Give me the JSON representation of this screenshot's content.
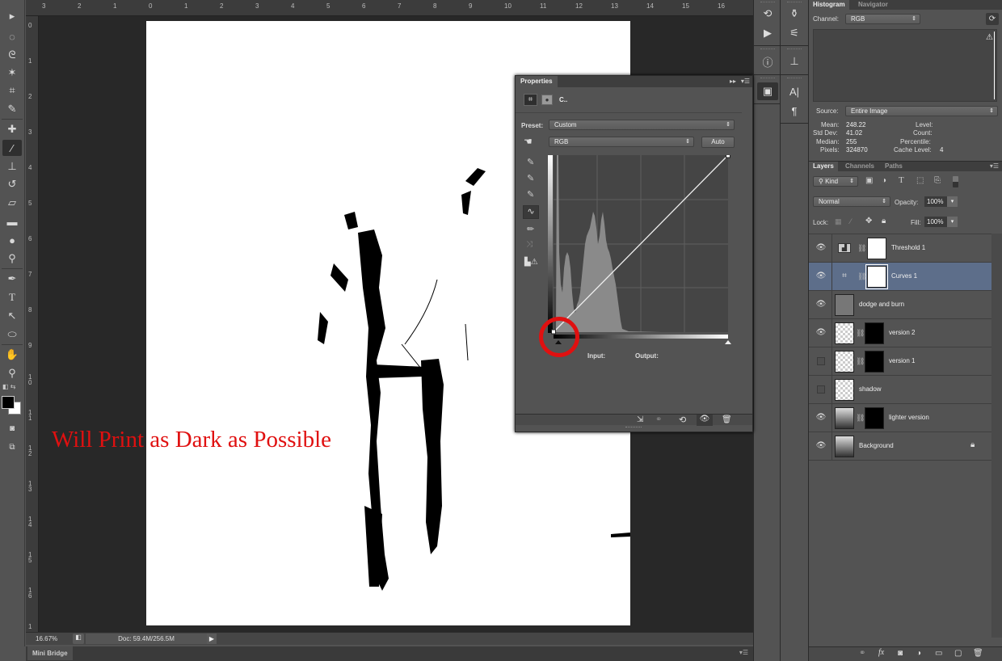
{
  "toolbar": {
    "tools": [
      {
        "name": "move-tool",
        "glyph": "▸✥"
      },
      {
        "name": "marquee-tool",
        "glyph": "◌"
      },
      {
        "name": "lasso-tool",
        "glyph": "ᘓ"
      },
      {
        "name": "magic-wand-tool",
        "glyph": "✶"
      },
      {
        "name": "crop-tool",
        "glyph": "⌗"
      },
      {
        "name": "eyedropper-tool",
        "glyph": "✎"
      },
      {
        "name": "healing-brush-tool",
        "glyph": "✚"
      },
      {
        "name": "brush-tool",
        "glyph": "⁄"
      },
      {
        "name": "clone-stamp-tool",
        "glyph": "⊥"
      },
      {
        "name": "history-brush-tool",
        "glyph": "↺"
      },
      {
        "name": "eraser-tool",
        "glyph": "▱"
      },
      {
        "name": "gradient-tool",
        "glyph": "▬"
      },
      {
        "name": "blur-tool",
        "glyph": "●"
      },
      {
        "name": "dodge-tool",
        "glyph": "⚲"
      },
      {
        "name": "pen-tool",
        "glyph": "✒"
      },
      {
        "name": "type-tool",
        "glyph": "T"
      },
      {
        "name": "path-selection-tool",
        "glyph": "↖"
      },
      {
        "name": "ellipse-tool",
        "glyph": "⬭"
      },
      {
        "name": "hand-tool",
        "glyph": "✋"
      },
      {
        "name": "zoom-tool",
        "glyph": "⚲"
      }
    ],
    "foreground_color": "#000000",
    "background_color": "#ffffff"
  },
  "rulers": {
    "top": [
      "3",
      "2",
      "1",
      "0",
      "1",
      "2",
      "3",
      "4",
      "5",
      "6",
      "7",
      "8",
      "9",
      "10",
      "11",
      "12",
      "13",
      "14",
      "15",
      "16"
    ],
    "left": [
      "0",
      "1",
      "2",
      "3",
      "4",
      "5",
      "6",
      "7",
      "8",
      "9",
      "10",
      "11",
      "12",
      "13",
      "14",
      "15",
      "16",
      "1"
    ]
  },
  "canvas": {
    "annotation_text": "Will Print as Dark as Possible",
    "annotation_color": "#e01010"
  },
  "status": {
    "zoom": "16.67%",
    "doc_size": "Doc: 59.4M/256.5M"
  },
  "mini_bridge": {
    "tab_label": "Mini Bridge"
  },
  "properties": {
    "title": "Properties",
    "adjustment_label": "C..",
    "preset_label": "Preset:",
    "preset_value": "Custom",
    "channel_value": "RGB",
    "auto_label": "Auto",
    "input_label": "Input:",
    "output_label": "Output:",
    "curve_points": [
      [
        0,
        0
      ],
      [
        255,
        255
      ]
    ]
  },
  "histogram": {
    "tabs": [
      "Histogram",
      "Navigator"
    ],
    "channel_label": "Channel:",
    "channel_value": "RGB",
    "source_label": "Source:",
    "source_value": "Entire Image",
    "stats": {
      "mean_label": "Mean:",
      "mean": "248.22",
      "std_label": "Std Dev:",
      "std": "41.02",
      "median_label": "Median:",
      "median": "255",
      "pixels_label": "Pixels:",
      "pixels": "324870",
      "level_label": "Level:",
      "level": "",
      "count_label": "Count:",
      "count": "",
      "percentile_label": "Percentile:",
      "percentile": "",
      "cache_label": "Cache Level:",
      "cache": "4"
    }
  },
  "layers_panel": {
    "tabs": [
      "Layers",
      "Channels",
      "Paths"
    ],
    "filter_value": "Kind",
    "blend_mode": "Normal",
    "opacity_label": "Opacity:",
    "opacity": "100%",
    "lock_label": "Lock:",
    "fill_label": "Fill:",
    "fill": "100%",
    "layers": [
      {
        "name": "Threshold 1",
        "visible": true,
        "selected": false,
        "type": "adjustment-threshold"
      },
      {
        "name": "Curves 1",
        "visible": true,
        "selected": true,
        "type": "adjustment-curves"
      },
      {
        "name": "dodge and burn",
        "visible": true,
        "selected": false,
        "type": "gray"
      },
      {
        "name": "version 2",
        "visible": true,
        "selected": false,
        "type": "masked"
      },
      {
        "name": "version 1",
        "visible": false,
        "selected": false,
        "type": "masked"
      },
      {
        "name": "shadow",
        "visible": false,
        "selected": false,
        "type": "transparent"
      },
      {
        "name": "lighter version",
        "visible": true,
        "selected": false,
        "type": "photo-masked"
      },
      {
        "name": "Background",
        "visible": true,
        "selected": false,
        "type": "photo-locked"
      }
    ]
  }
}
